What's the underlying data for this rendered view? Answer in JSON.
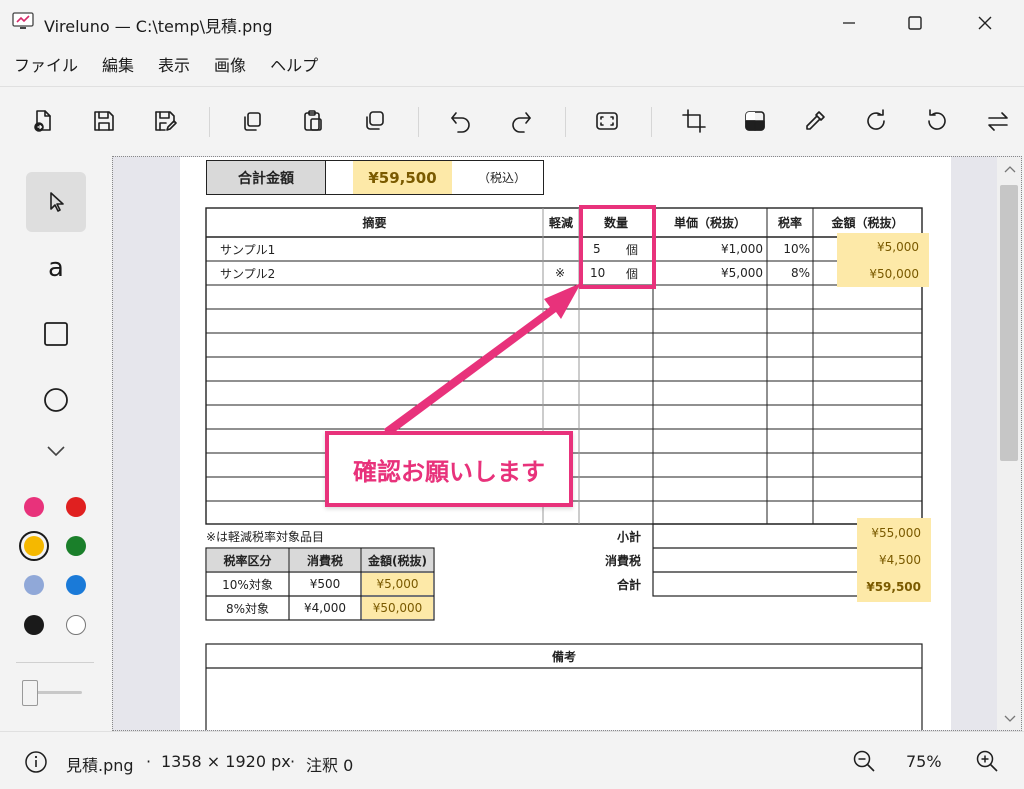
{
  "window": {
    "title": "Vireluno — C:\\temp\\見積.png"
  },
  "menu": [
    "ファイル",
    "編集",
    "表示",
    "画像",
    "ヘルプ"
  ],
  "toolbar": {
    "icons": [
      "open-icon",
      "save-icon",
      "save-as-icon",
      "copy-icon",
      "paste-icon",
      "duplicate-icon",
      "undo-icon",
      "redo-icon",
      "fit-screen-icon",
      "crop-icon",
      "invert-icon",
      "eyedropper-icon",
      "rotate-right-icon",
      "rotate-left-icon",
      "flip-icon"
    ]
  },
  "sidebar": {
    "text_tool": "a",
    "colors": [
      "#e8327b",
      "#e02020",
      "#f5b800",
      "#1a7f2a",
      "#90a8d8",
      "#1a7ad8",
      "#1a1a1a",
      "#ffffff"
    ],
    "selected_color": "#f5b800"
  },
  "doc": {
    "total_label": "合計金額",
    "total_value": "¥59,500",
    "tax_incl": "（税込）",
    "headers": [
      "摘要",
      "軽減",
      "数量",
      "単価（税抜）",
      "税率",
      "金額（税抜）"
    ],
    "rows": [
      {
        "item": "サンプル1",
        "reduced": "",
        "qty": "5",
        "unit": "個",
        "price": "¥1,000",
        "rate": "10%",
        "amount": "¥5,000"
      },
      {
        "item": "サンプル2",
        "reduced": "※",
        "qty": "10",
        "unit": "個",
        "price": "¥5,000",
        "rate": "8%",
        "amount": "¥50,000"
      }
    ],
    "note": "※は軽減税率対象品目",
    "tax_table": {
      "headers": [
        "税率区分",
        "消費税",
        "金額(税抜)"
      ],
      "rows": [
        [
          "10%対象",
          "¥500",
          "¥5,000"
        ],
        [
          "8%対象",
          "¥4,000",
          "¥50,000"
        ]
      ]
    },
    "summary": [
      {
        "label": "小計",
        "value": "¥55,000"
      },
      {
        "label": "消費税",
        "value": "¥4,500"
      },
      {
        "label": "合計",
        "value": "¥59,500"
      }
    ],
    "remarks": "備考"
  },
  "annotation": {
    "text": "確認お願いします",
    "color": "#e8327b"
  },
  "status": {
    "file": "見積.png",
    "dims": "1358 × 1920 px",
    "notes": "注釈 0",
    "sep": "·",
    "zoom": "75%"
  }
}
